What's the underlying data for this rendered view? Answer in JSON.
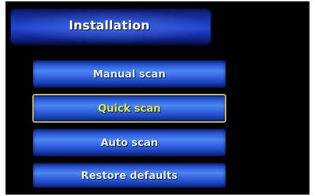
{
  "header": {
    "title": "Installation"
  },
  "menu": {
    "items": [
      {
        "label": "Manual scan"
      },
      {
        "label": "Quick scan",
        "selected": true
      },
      {
        "label": "Auto scan"
      },
      {
        "label": "Restore defaults"
      }
    ]
  },
  "colors": {
    "background": "#000000",
    "button_blue": "#3a6ee6",
    "selection_outline": "#d4c23a",
    "selected_text": "#d9e84a",
    "text": "#e9eef8"
  }
}
